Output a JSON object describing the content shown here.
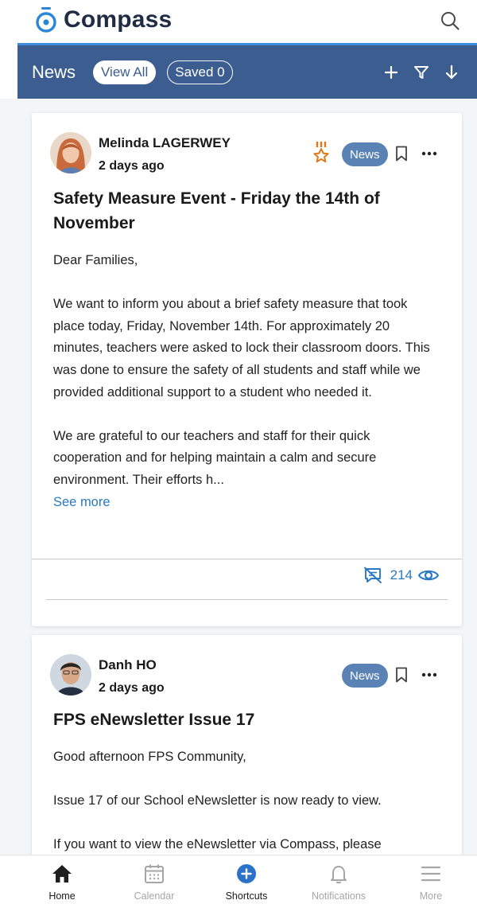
{
  "app": {
    "logo_text": "Compass"
  },
  "colors": {
    "brand_blue": "#3c5d8f",
    "accent": "#3b8ddb",
    "link": "#2a79c2",
    "tag": "#5b82b4",
    "badge_orange": "#e0791a"
  },
  "newsbar": {
    "title": "News",
    "view_all": "View All",
    "saved": "Saved 0",
    "icons": [
      "plus-icon",
      "filter-icon",
      "sort-down-icon"
    ]
  },
  "posts": [
    {
      "author": "Melinda LAGERWEY",
      "time": "2 days ago",
      "tag": "News",
      "title_lines": [
        "Safety Measure Event - Friday the 14th of",
        "November"
      ],
      "body": [
        "Dear Families,",
        "We want to inform you about a brief safety measure that took place today, Friday, November 14th. For approximately 20 minutes, teachers were asked to lock their classroom doors. This was done to ensure the safety of all students and staff while we provided additional support to a student who needed it.",
        "We are grateful to our teachers and staff for their quick cooperation and for helping maintain a calm and secure environment. Their efforts h..."
      ],
      "see_more": "See more",
      "views": "214"
    },
    {
      "author": "Danh HO",
      "time": "2 days ago",
      "tag": "News",
      "title": "FPS eNewsletter Issue 17",
      "body": [
        "Good afternoon FPS Community,",
        "Issue 17 of our School eNewsletter is now ready to view.",
        "If you want to view the eNewsletter via Compass, please"
      ]
    }
  ],
  "bottom_nav": [
    {
      "label": "Home",
      "icon": "home-icon",
      "active": true
    },
    {
      "label": "Calendar",
      "icon": "calendar-icon",
      "active": false
    },
    {
      "label": "Shortcuts",
      "icon": "shortcuts-plus-icon",
      "active": true
    },
    {
      "label": "Notifications",
      "icon": "bell-icon",
      "active": false
    },
    {
      "label": "More",
      "icon": "menu-icon",
      "active": false
    }
  ]
}
